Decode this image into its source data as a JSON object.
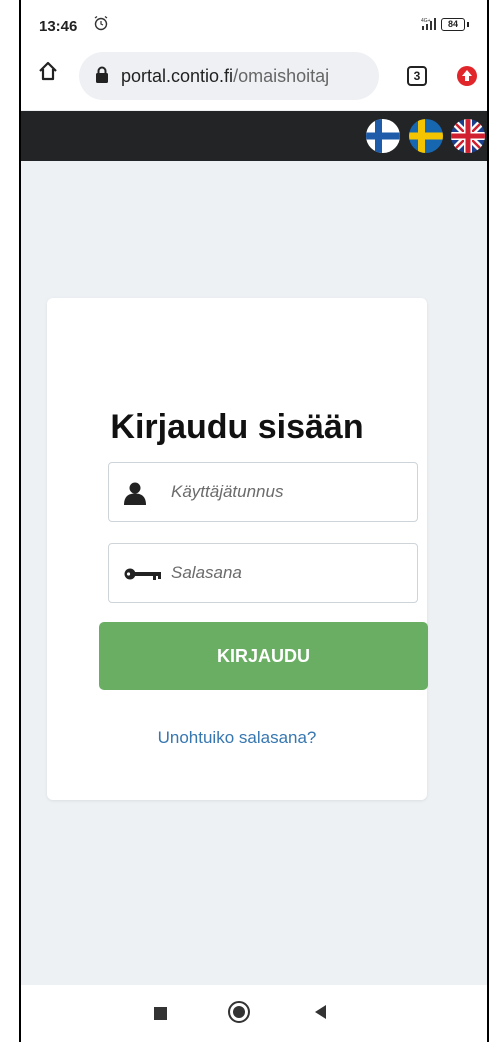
{
  "status": {
    "time": "13:46",
    "network": "4G+",
    "battery": "84"
  },
  "browser": {
    "url_host": "portal.contio.fi",
    "url_path": "/omaishoitaj",
    "tab_count": "3"
  },
  "languages": [
    "fi",
    "sv",
    "en"
  ],
  "login": {
    "title": "Kirjaudu sisään",
    "username_placeholder": "Käyttäjätunnus",
    "password_placeholder": "Salasana",
    "submit_label": "KIRJAUDU",
    "forgot_label": "Unohtuiko salasana?"
  },
  "colors": {
    "accent": "#6aae63",
    "link": "#3777b0",
    "header": "#222426",
    "background": "#edf1f4"
  }
}
